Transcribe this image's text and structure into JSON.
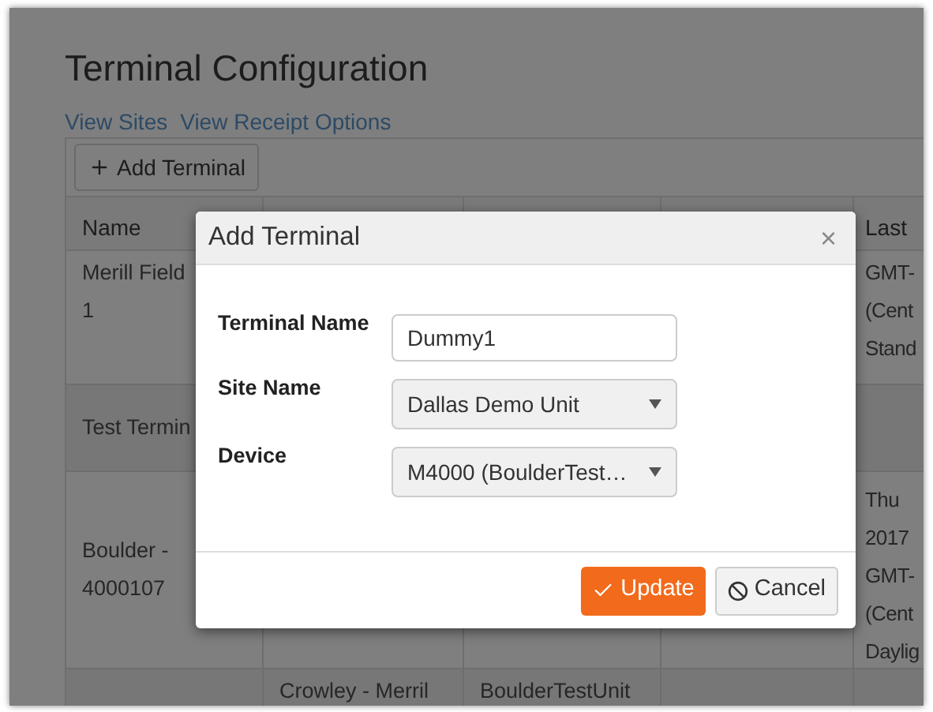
{
  "page": {
    "title": "Terminal Configuration",
    "links": [
      "View Sites",
      "View Receipt Options"
    ],
    "add_button": "Add Terminal"
  },
  "table": {
    "header": {
      "column_1": "Name",
      "column_5": "Last"
    },
    "rows": [
      {
        "column_1": [
          "Merill Field",
          "1"
        ],
        "column_5": [
          "GMT-",
          "(Cent",
          "Stand"
        ]
      },
      {
        "column_1": [
          "Test Termin"
        ]
      },
      {
        "column_1": [
          "Boulder -",
          "4000107"
        ],
        "column_5": [
          "Thu",
          "2017",
          "GMT-",
          "(Cent",
          "Daylig"
        ]
      },
      {
        "column_2": [
          "Crowley - Merril"
        ],
        "column_3": [
          "BoulderTestUnit"
        ]
      }
    ]
  },
  "dialog": {
    "title": "Add Terminal",
    "close": "×",
    "fields": [
      {
        "kind": "text",
        "label": "Terminal Name",
        "value": "Dummy1"
      },
      {
        "kind": "select",
        "label": "Site Name",
        "value": "Dallas Demo Unit"
      },
      {
        "kind": "select",
        "label": "Device",
        "value": "M4000 (BoulderTest…"
      }
    ],
    "buttons": [
      {
        "kind": "primary",
        "label": "Update"
      },
      {
        "kind": "cancel",
        "label": "Cancel"
      }
    ]
  }
}
